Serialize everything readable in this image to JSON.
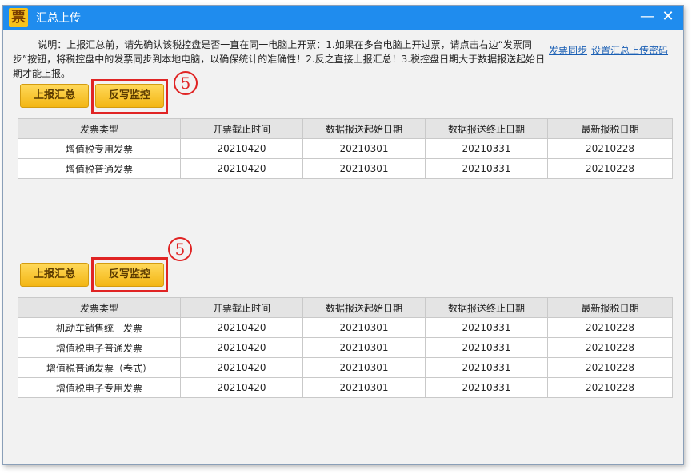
{
  "window": {
    "title": "汇总上传",
    "logo_char": "票",
    "minimize": "—",
    "close": "✕"
  },
  "description": "说明：上报汇总前，请先确认该税控盘是否一直在同一电脑上开票：1.如果在多台电脑上开过票，请点击右边“发票同步”按钮，将税控盘中的发票同步到本地电脑，以确保统计的准确性！2.反之直接上报汇总！3.税控盘日期大于数据报送起始日期才能上报。",
  "links": {
    "sync": "发票同步",
    "set_password": "设置汇总上传密码"
  },
  "buttons": {
    "report": "上报汇总",
    "writeback": "反写监控"
  },
  "marker": "5",
  "columns": [
    "发票类型",
    "开票截止时间",
    "数据报送起始日期",
    "数据报送终止日期",
    "最新报税日期"
  ],
  "table1": [
    [
      "增值税专用发票",
      "20210420",
      "20210301",
      "20210331",
      "20210228"
    ],
    [
      "增值税普通发票",
      "20210420",
      "20210301",
      "20210331",
      "20210228"
    ]
  ],
  "table2": [
    [
      "机动车销售统一发票",
      "20210420",
      "20210301",
      "20210331",
      "20210228"
    ],
    [
      "增值税电子普通发票",
      "20210420",
      "20210301",
      "20210331",
      "20210228"
    ],
    [
      "增值税普通发票（卷式）",
      "20210420",
      "20210301",
      "20210331",
      "20210228"
    ],
    [
      "增值税电子专用发票",
      "20210420",
      "20210301",
      "20210331",
      "20210228"
    ]
  ],
  "colors": {
    "titlebar": "#1f8cee",
    "button": "#f3b614",
    "highlight": "#e02424",
    "link": "#1a5fb4"
  }
}
